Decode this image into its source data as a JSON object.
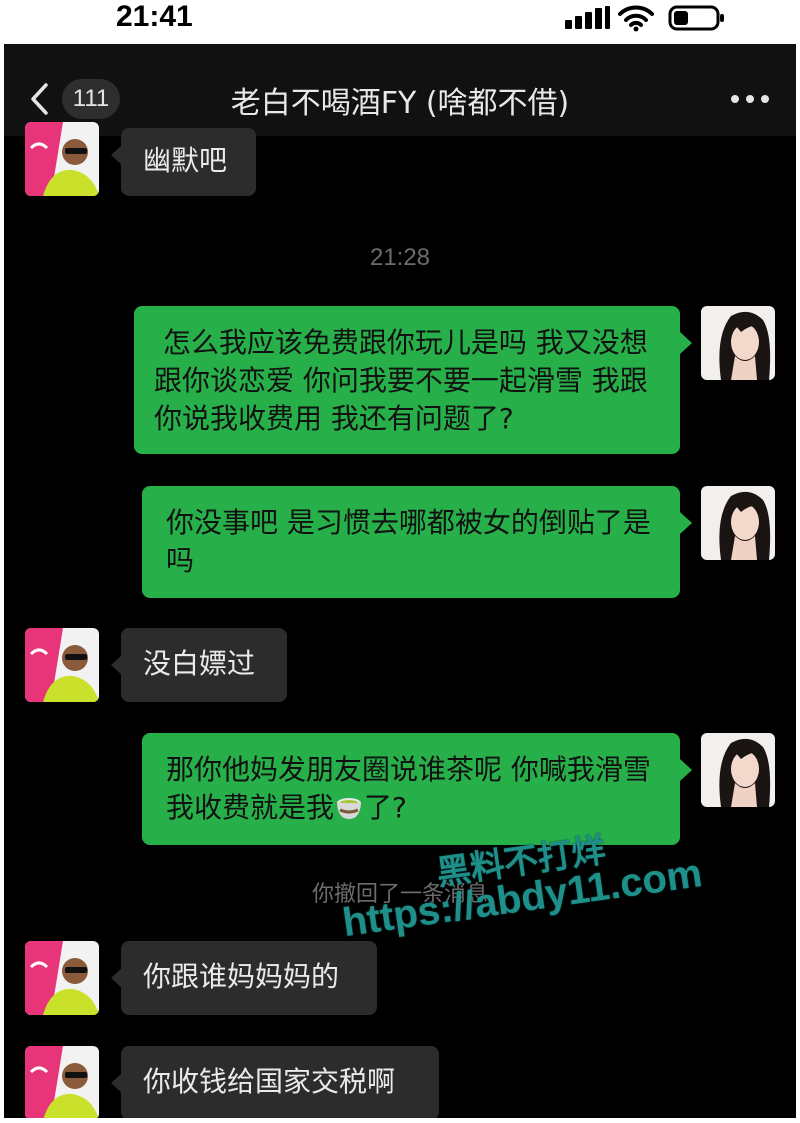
{
  "status_bar": {
    "time": "21:41"
  },
  "nav": {
    "unread_count": "111",
    "title": "老白不喝酒FY (啥都不借)"
  },
  "messages": [
    {
      "side": "in",
      "text": "幽默吧"
    },
    {
      "side": "time",
      "text": "21:28"
    },
    {
      "side": "out",
      "text": " 怎么我应该免费跟你玩儿是吗 我又没想跟你谈恋爱 你问我要不要一起滑雪 我跟你说我收费用 我还有问题了?"
    },
    {
      "side": "out",
      "text": "你没事吧 是习惯去哪都被女的倒贴了是吗"
    },
    {
      "side": "in",
      "text": "没白嫖过"
    },
    {
      "side": "out",
      "text_before": "那你他妈发朋友圈说谁茶呢 你喊我滑雪我收费就是我",
      "emoji": "tea-cup-icon",
      "text_after": "了?"
    },
    {
      "side": "system",
      "text": "你撤回了一条消息"
    },
    {
      "side": "in",
      "text": "你跟谁妈妈妈的"
    },
    {
      "side": "in",
      "text": "你收钱给国家交税啊"
    }
  ],
  "watermark": {
    "line1": "黑料不打烊",
    "line2": "https://abdy11.com"
  },
  "colors": {
    "outgoing_bubble": "#27b04a",
    "incoming_bubble": "#2c2c2c",
    "background": "#000000"
  }
}
